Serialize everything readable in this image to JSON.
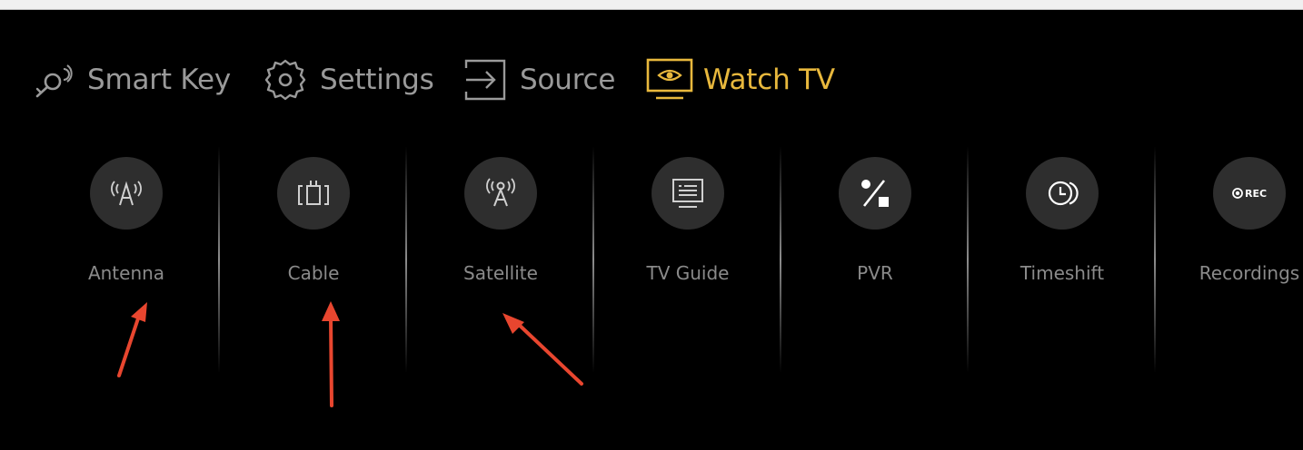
{
  "nav": {
    "items": [
      {
        "label": "Smart Key",
        "icon": "smart-key-icon",
        "active": false
      },
      {
        "label": "Settings",
        "icon": "gear-icon",
        "active": false
      },
      {
        "label": "Source",
        "icon": "source-input-icon",
        "active": false
      },
      {
        "label": "Watch TV",
        "icon": "watch-tv-icon",
        "active": true
      }
    ]
  },
  "menu": {
    "items": [
      {
        "label": "Antenna",
        "icon": "antenna-icon"
      },
      {
        "label": "Cable",
        "icon": "cable-icon"
      },
      {
        "label": "Satellite",
        "icon": "satellite-icon"
      },
      {
        "label": "TV Guide",
        "icon": "tv-guide-icon"
      },
      {
        "label": "PVR",
        "icon": "pvr-icon"
      },
      {
        "label": "Timeshift",
        "icon": "timeshift-icon"
      },
      {
        "label": "Recordings",
        "icon": "recordings-icon",
        "badge": "REC"
      }
    ]
  },
  "colors": {
    "background": "#000000",
    "inactive_text": "#9a9a9a",
    "active_accent": "#e8b83d",
    "icon_circle": "#2e2e2e",
    "annotation_arrow": "#e8462f"
  }
}
